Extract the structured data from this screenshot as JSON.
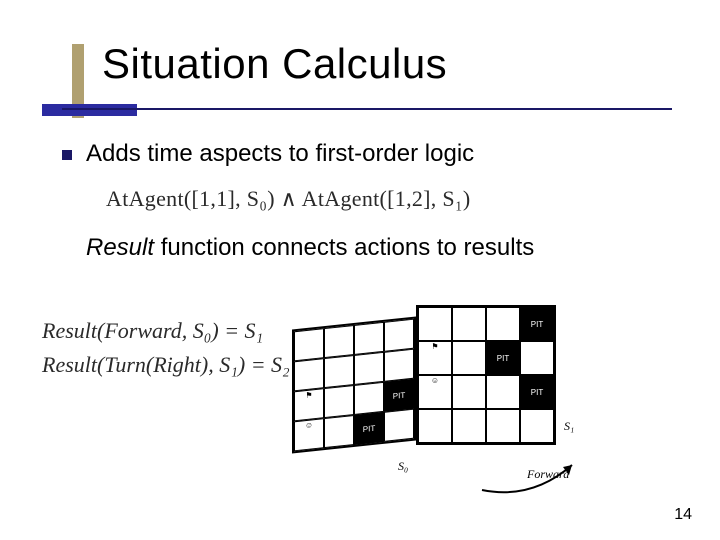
{
  "title": "Situation Calculus",
  "bullet1": "Adds time aspects to first-order logic",
  "formula_top": "AtAgent([1,1], S₀) ∧ AtAgent([1,2], S₁)",
  "result_line_italic": "Result",
  "result_line_rest": " function connects actions to results",
  "eq1": "Result(Forward, S₀) = S₁",
  "eq2": "Result(Turn(Right), S₁) = S₂",
  "fig_label_s0": "S₀",
  "fig_label_s1": "S₁",
  "fig_label_forward": "Forward",
  "pit_label": "PIT",
  "page_number": "14"
}
